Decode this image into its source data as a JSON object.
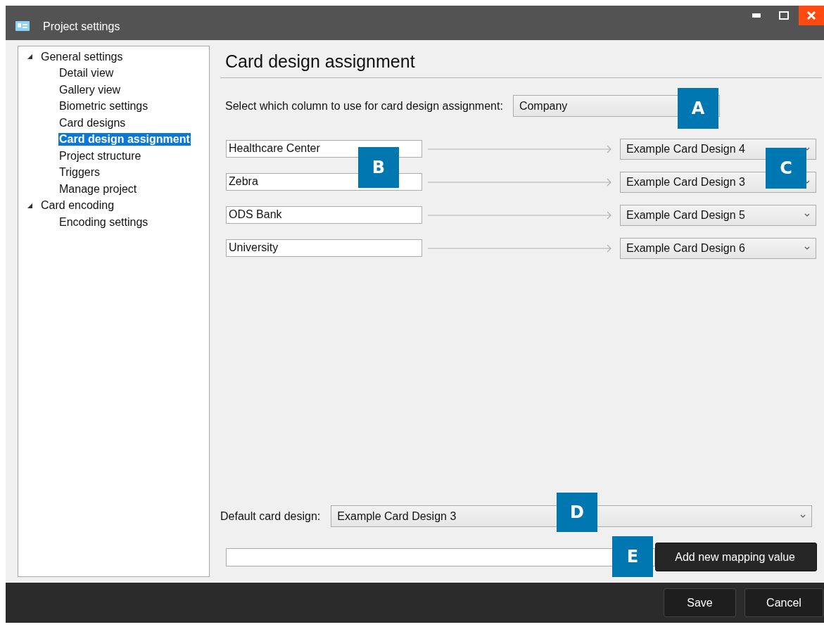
{
  "window": {
    "title": "Project settings"
  },
  "sidebar": {
    "items": [
      {
        "label": "General settings",
        "expanded": true,
        "selected": false,
        "children": [
          {
            "label": "Detail view",
            "selected": false
          },
          {
            "label": "Gallery view",
            "selected": false
          },
          {
            "label": "Biometric settings",
            "selected": false
          },
          {
            "label": "Card designs",
            "selected": false
          },
          {
            "label": "Card design assignment",
            "selected": true
          },
          {
            "label": "Project structure",
            "selected": false
          },
          {
            "label": "Triggers",
            "selected": false
          },
          {
            "label": "Manage project",
            "selected": false
          }
        ]
      },
      {
        "label": "Card encoding",
        "expanded": true,
        "selected": false,
        "children": [
          {
            "label": "Encoding settings",
            "selected": false
          }
        ]
      }
    ]
  },
  "content": {
    "heading": "Card design assignment",
    "column_label": "Select which column to use for card design assignment:",
    "column_select": "Company",
    "mappings": [
      {
        "value": "Healthcare Center",
        "design": "Example Card Design 4"
      },
      {
        "value": "Zebra",
        "design": "Example Card Design 3"
      },
      {
        "value": "ODS Bank",
        "design": "Example Card Design 5"
      },
      {
        "value": "University",
        "design": "Example Card Design 6"
      }
    ],
    "default_label": "Default card design:",
    "default_select": "Example Card Design 3",
    "add_button": "Add new mapping value"
  },
  "footer": {
    "buttons": [
      "Save",
      "Cancel"
    ]
  },
  "callouts": [
    "A",
    "B",
    "C",
    "D",
    "E"
  ]
}
